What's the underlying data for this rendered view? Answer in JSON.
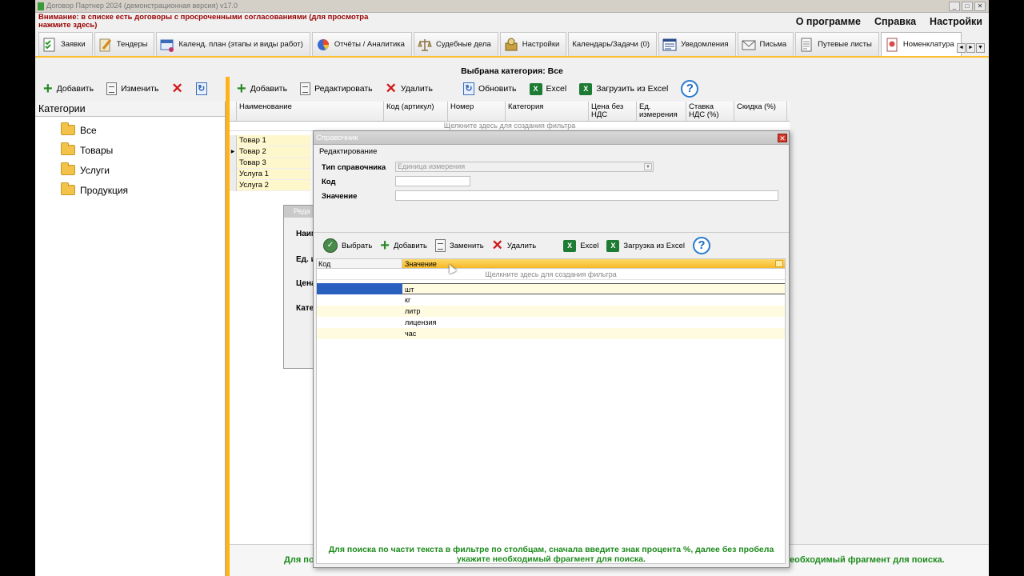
{
  "window": {
    "title": "Договор Партнер 2024 (демонстрационная версия) v17.0"
  },
  "warning": "Внимание: в списке есть договоры с просроченными согласованиями (для просмотра нажмите здесь)",
  "topmenu": [
    "О программе",
    "Справка",
    "Настройки"
  ],
  "tabs": [
    {
      "label": "Заявки",
      "icon": "checklist-icon"
    },
    {
      "label": "Тендеры",
      "icon": "pencil-doc-icon"
    },
    {
      "label": "Календ. план (этапы и виды работ)",
      "icon": "calendar-plan-icon"
    },
    {
      "label": "Отчёты / Аналитика",
      "icon": "pie-chart-icon"
    },
    {
      "label": "Судебные дела",
      "icon": "scales-icon"
    },
    {
      "label": "Настройки",
      "icon": "settings-icon"
    },
    {
      "label": "Календарь/Задачи (0)",
      "icon": "calendar-icon"
    },
    {
      "label": "Уведомления",
      "icon": "notification-icon"
    },
    {
      "label": "Письма",
      "icon": "envelope-icon"
    },
    {
      "label": "Путевые листы",
      "icon": "document-icon"
    },
    {
      "label": "Номенклатура",
      "icon": "catalog-icon",
      "active": true
    }
  ],
  "category_header": "Выбрана категория: Все",
  "left_toolbar": {
    "add": "Добавить",
    "edit": "Изменить"
  },
  "categories": {
    "header": "Категории",
    "items": [
      "Все",
      "Товары",
      "Услуги",
      "Продукция"
    ]
  },
  "main_toolbar": {
    "add": "Добавить",
    "edit": "Редактировать",
    "delete": "Удалить",
    "refresh": "Обновить",
    "excel": "Excel",
    "load_excel": "Загрузить из Excel"
  },
  "grid": {
    "columns": [
      "Наименование",
      "Код (артикул)",
      "Номер",
      "Категория",
      "Цена без НДС",
      "Ед. измерения",
      "Ставка НДС (%)",
      "Скидка (%)"
    ],
    "filter_hint": "Щелкните здесь для создания фильтра",
    "rows": [
      "Товар 1",
      "Товар 2",
      "Товар 3",
      "Услуга 1",
      "Услуга 2"
    ]
  },
  "bg_dialog": {
    "caption": "Реда",
    "labels": [
      "Наим",
      "Ед. и",
      "Цена",
      "Кате"
    ]
  },
  "bottom_hint": {
    "left": "Для по",
    "right": "еобходимый фрагмент для поиска."
  },
  "modal": {
    "caption": "Справочник",
    "section": "Редактирование",
    "type_label": "Тип справочника",
    "type_value": "Единица измерения",
    "code_label": "Код",
    "code_value": "",
    "value_label": "Значение",
    "value_value": "",
    "toolbar": {
      "select": "Выбрать",
      "add": "Добавить",
      "replace": "Заменить",
      "delete": "Удалить",
      "excel": "Excel",
      "load_excel": "Загрузка из Excel"
    },
    "grid": {
      "col_code": "Код",
      "col_value": "Значение",
      "filter_hint": "Щелкните здесь для создания фильтра",
      "rows": [
        {
          "code": "",
          "value": "шт"
        },
        {
          "code": "",
          "value": "кг"
        },
        {
          "code": "",
          "value": "литр"
        },
        {
          "code": "",
          "value": "лицензия"
        },
        {
          "code": "",
          "value": "час"
        }
      ]
    },
    "hint": "Для поиска по части текста в фильтре по столбцам, сначала введите знак процента %, далее без пробела укажите необходимый фрагмент для поиска."
  },
  "colors": {
    "accent": "#ffb21a",
    "hint_green": "#1c8a1c",
    "selected_blue": "#2960c0"
  }
}
